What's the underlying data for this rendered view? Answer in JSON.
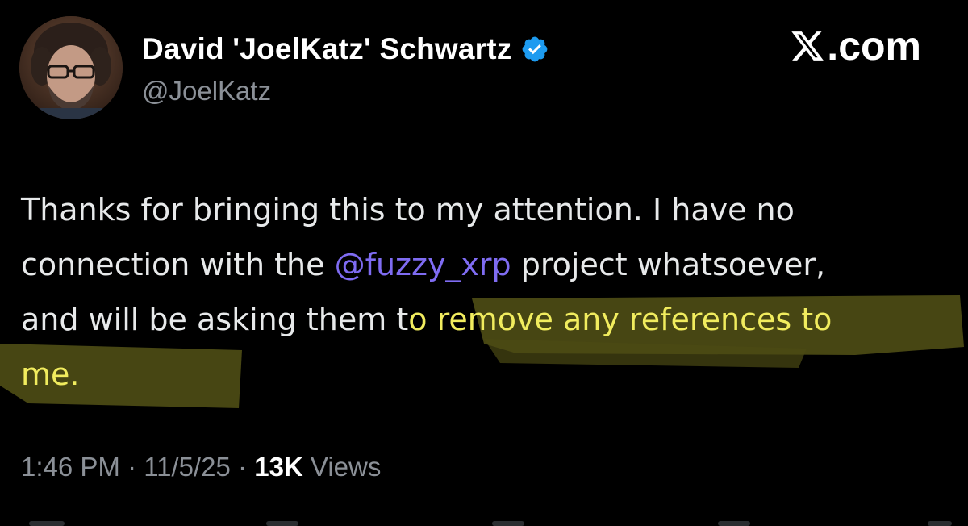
{
  "author": {
    "display_name": "David 'JoelKatz' Schwartz",
    "handle": "@JoelKatz",
    "verified_icon": "verified-badge-icon",
    "verified_color": "#1d9bf0"
  },
  "brand": {
    "logo_icon": "x-logo-icon",
    "domain_suffix": ".com"
  },
  "post": {
    "line1": "Thanks for bringing this to my attention. I have no",
    "line2_before": "connection with the ",
    "mention": "@fuzzy_xrp",
    "line2_after": " project whatsoever,",
    "line3_plain": "and will be asking them t",
    "line3_highlight": "o remove any references to",
    "line4_highlight": "me."
  },
  "meta": {
    "time": "1:46 PM",
    "sep1": " · ",
    "date": "11/5/25",
    "sep2": " · ",
    "views_count": "13K",
    "views_label": " Views"
  },
  "colors": {
    "background": "#000000",
    "text": "#e7e9ea",
    "secondary": "#8b9097",
    "mention": "#7f6cf2",
    "highlight_text": "#f1ec5e",
    "highlight_marker": "#4a4a12"
  }
}
